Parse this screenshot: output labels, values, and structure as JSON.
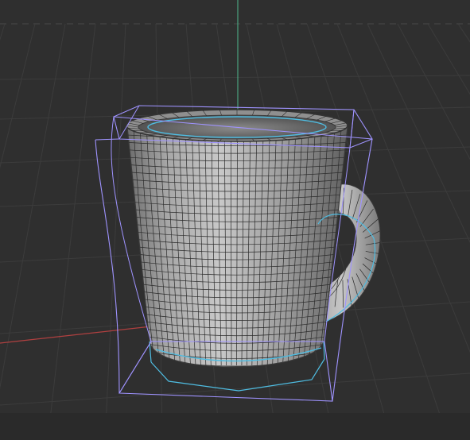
{
  "viewport": {
    "view": "perspective",
    "background_color": "#2f2f2f",
    "grid_color": "#3c3c3c",
    "axis_colors": {
      "x": "#b04040",
      "y": "#4aa37f"
    }
  },
  "scene_object": {
    "name": "mug-mesh",
    "type": "subdivision-surface",
    "surface_color": "#a7a7a7",
    "wire_color": "#2b2b2b"
  },
  "deformer_cage": {
    "type": "lattice-cage",
    "color": "#9f93ff"
  },
  "selection_highlight": {
    "color": "#4fbde2"
  }
}
